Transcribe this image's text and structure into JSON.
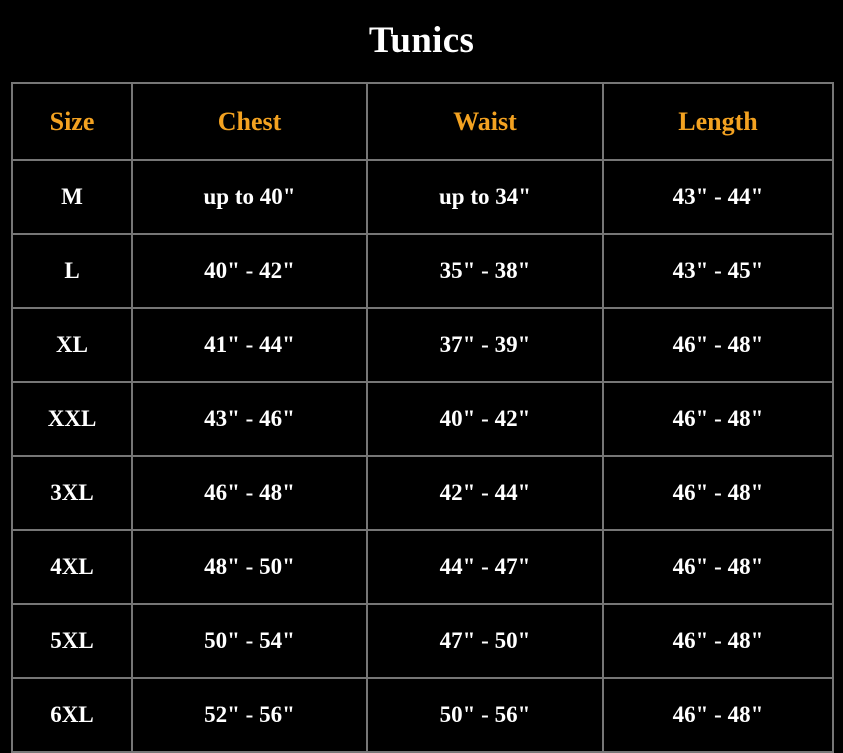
{
  "document": {
    "title": "Tunics",
    "background_color": "#000000",
    "title_color": "#ffffff",
    "header_color": "#f3a221",
    "cell_color": "#ffffff",
    "border_color": "#767676"
  },
  "table": {
    "columns": [
      {
        "key": "size",
        "label": "Size"
      },
      {
        "key": "chest",
        "label": "Chest"
      },
      {
        "key": "waist",
        "label": "Waist"
      },
      {
        "key": "length",
        "label": "Length"
      }
    ],
    "rows": [
      {
        "size": "M",
        "chest": "up to 40\"",
        "waist": "up to 34\"",
        "length": "43\" - 44\""
      },
      {
        "size": "L",
        "chest": "40\" - 42\"",
        "waist": "35\" - 38\"",
        "length": "43\" - 45\""
      },
      {
        "size": "XL",
        "chest": "41\" - 44\"",
        "waist": "37\" - 39\"",
        "length": "46\" - 48\""
      },
      {
        "size": "XXL",
        "chest": "43\" - 46\"",
        "waist": "40\" - 42\"",
        "length": "46\" - 48\""
      },
      {
        "size": "3XL",
        "chest": "46\" - 48\"",
        "waist": "42\" - 44\"",
        "length": "46\" - 48\""
      },
      {
        "size": "4XL",
        "chest": "48\" - 50\"",
        "waist": "44\" - 47\"",
        "length": "46\" - 48\""
      },
      {
        "size": "5XL",
        "chest": "50\" - 54\"",
        "waist": "47\" - 50\"",
        "length": "46\" - 48\""
      },
      {
        "size": "6XL",
        "chest": "52\" - 56\"",
        "waist": "50\" - 56\"",
        "length": "46\" - 48\""
      }
    ]
  }
}
